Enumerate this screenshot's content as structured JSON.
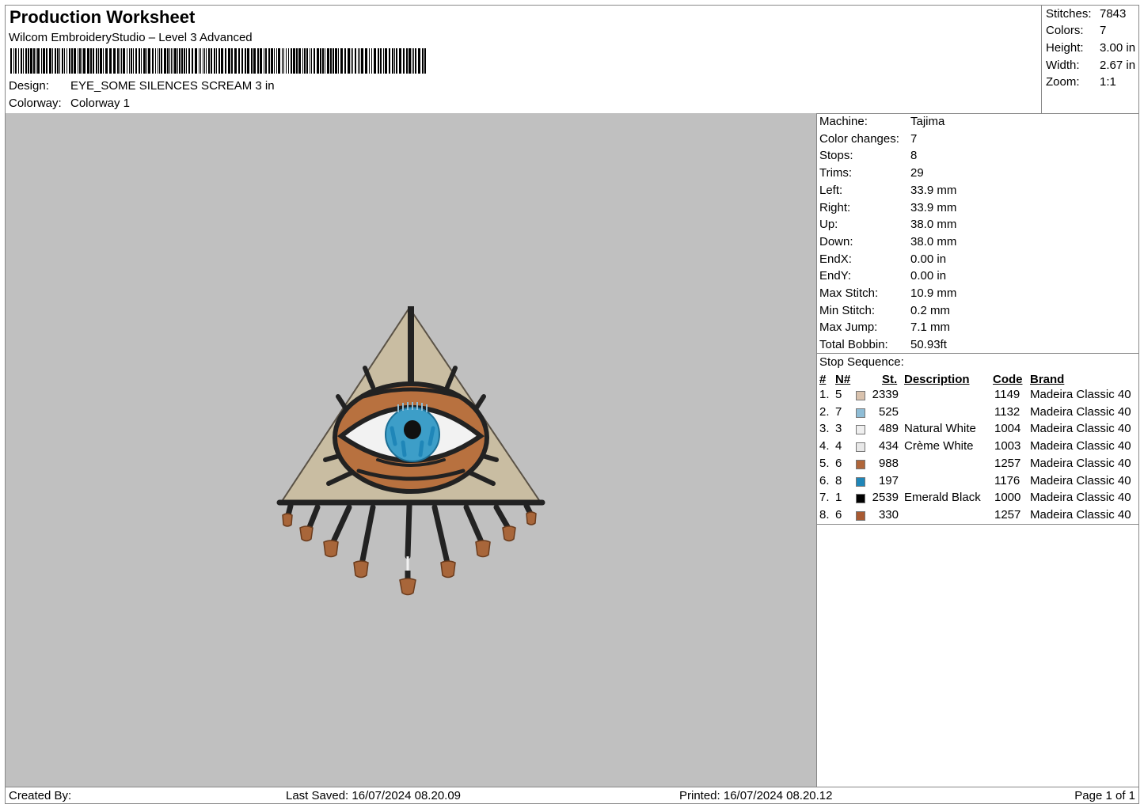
{
  "header": {
    "title": "Production Worksheet",
    "software": "Wilcom EmbroideryStudio – Level 3 Advanced",
    "design_label": "Design:",
    "design_value": "EYE_SOME SILENCES SCREAM 3 in",
    "colorway_label": "Colorway:",
    "colorway_value": "Colorway 1"
  },
  "stats": [
    {
      "label": "Stitches:",
      "value": "7843"
    },
    {
      "label": "Colors:",
      "value": "7"
    },
    {
      "label": "Height:",
      "value": "3.00 in"
    },
    {
      "label": "Width:",
      "value": "2.67 in"
    },
    {
      "label": "Zoom:",
      "value": "1:1"
    }
  ],
  "machine_info": [
    {
      "label": "Machine:",
      "value": "Tajima"
    },
    {
      "label": "Color changes:",
      "value": "7"
    },
    {
      "label": "Stops:",
      "value": "8"
    },
    {
      "label": "Trims:",
      "value": "29"
    },
    {
      "label": "Left:",
      "value": "33.9 mm"
    },
    {
      "label": "Right:",
      "value": "33.9 mm"
    },
    {
      "label": "Up:",
      "value": "38.0 mm"
    },
    {
      "label": "Down:",
      "value": "38.0 mm"
    },
    {
      "label": "EndX:",
      "value": "0.00 in"
    },
    {
      "label": "EndY:",
      "value": "0.00 in"
    },
    {
      "label": "Max Stitch:",
      "value": "10.9 mm"
    },
    {
      "label": "Min Stitch:",
      "value": "0.2 mm"
    },
    {
      "label": "Max Jump:",
      "value": "7.1 mm"
    },
    {
      "label": "Total Bobbin:",
      "value": "50.93ft"
    }
  ],
  "stop_sequence": {
    "title": "Stop Sequence:",
    "columns": {
      "num": "#",
      "n": "N#",
      "st": "St.",
      "description": "Description",
      "code": "Code",
      "brand": "Brand"
    },
    "rows": [
      {
        "num": "1.",
        "n": "5",
        "color": "#d9c2ad",
        "st": "2339",
        "description": "",
        "code": "1149",
        "brand": "Madeira Classic 40"
      },
      {
        "num": "2.",
        "n": "7",
        "color": "#8fbdd6",
        "st": "525",
        "description": "",
        "code": "1132",
        "brand": "Madeira Classic 40"
      },
      {
        "num": "3.",
        "n": "3",
        "color": "#efefef",
        "st": "489",
        "description": "Natural White",
        "code": "1004",
        "brand": "Madeira Classic 40"
      },
      {
        "num": "4.",
        "n": "4",
        "color": "#e8e8e8",
        "st": "434",
        "description": "Crème White",
        "code": "1003",
        "brand": "Madeira Classic 40"
      },
      {
        "num": "5.",
        "n": "6",
        "color": "#b0663a",
        "st": "988",
        "description": "",
        "code": "1257",
        "brand": "Madeira Classic 40"
      },
      {
        "num": "6.",
        "n": "8",
        "color": "#1f86b8",
        "st": "197",
        "description": "",
        "code": "1176",
        "brand": "Madeira Classic 40"
      },
      {
        "num": "7.",
        "n": "1",
        "color": "#000000",
        "st": "2539",
        "description": "Emerald Black",
        "code": "1000",
        "brand": "Madeira Classic 40"
      },
      {
        "num": "8.",
        "n": "6",
        "color": "#a85a32",
        "st": "330",
        "description": "",
        "code": "1257",
        "brand": "Madeira Classic 40"
      }
    ]
  },
  "footer": {
    "created_by": "Created By:",
    "last_saved": "Last Saved: 16/07/2024 08.20.09",
    "printed": "Printed: 16/07/2024 08.20.12",
    "page": "Page 1 of 1"
  }
}
